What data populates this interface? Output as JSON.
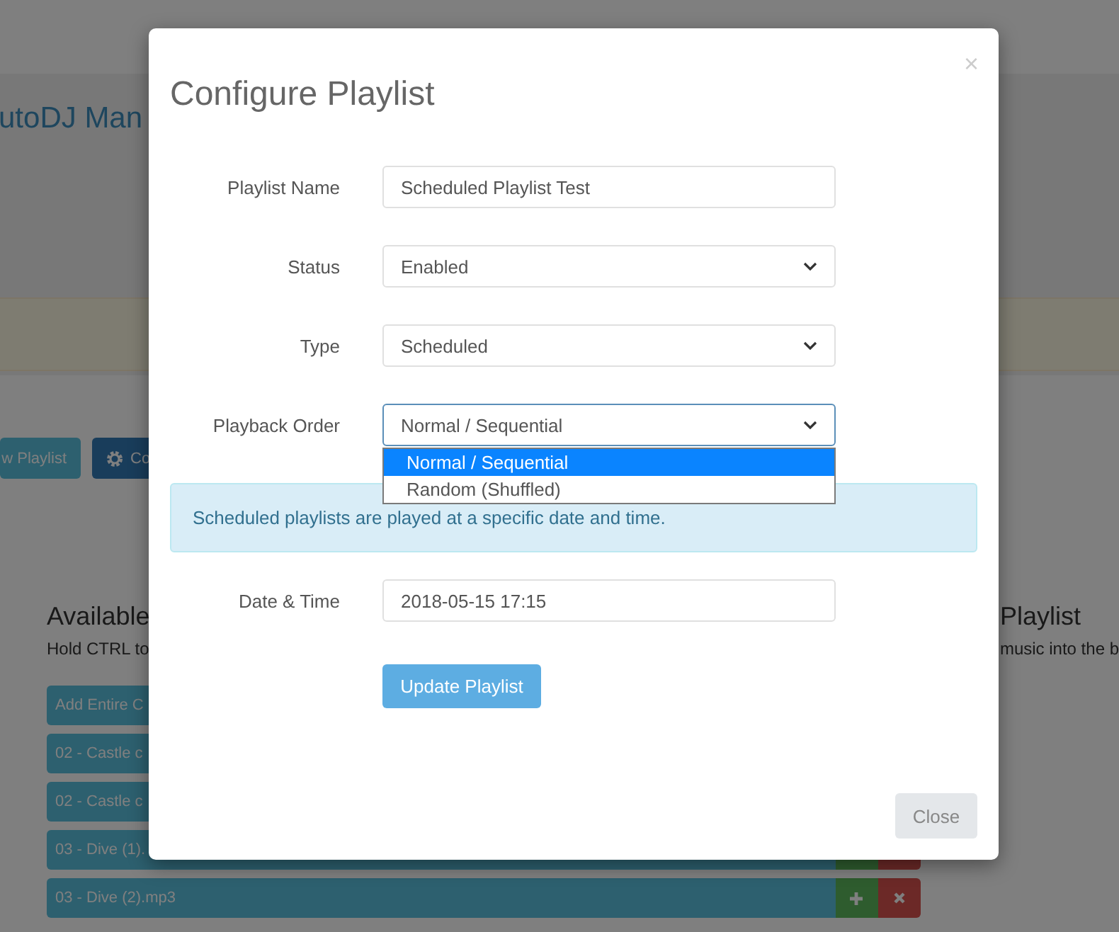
{
  "background": {
    "page_title": "utoDJ Man",
    "buttons": [
      {
        "label": "w Playlist",
        "kind": "info"
      },
      {
        "label": "Co",
        "kind": "primary"
      }
    ],
    "available": {
      "heading": "Available",
      "hint": "Hold CTRL to",
      "items": [
        {
          "label": "Add Entire C",
          "kind": "action"
        },
        {
          "label": "02 - Castle c",
          "kind": "track"
        },
        {
          "label": "02 - Castle c",
          "kind": "track"
        },
        {
          "label": "03 - Dive (1).",
          "kind": "song_covered"
        },
        {
          "label": "03 - Dive (2).mp3",
          "kind": "song"
        }
      ]
    },
    "playlist": {
      "heading": "Playlist",
      "hint": "music into the b"
    }
  },
  "modal": {
    "title": "Configure Playlist",
    "close": "×",
    "fields": [
      {
        "label": "Playlist Name",
        "kind": "text",
        "value": "Scheduled Playlist Test"
      },
      {
        "label": "Status",
        "kind": "select",
        "value": "Enabled",
        "expanded": false
      },
      {
        "label": "Type",
        "kind": "select",
        "value": "Scheduled",
        "expanded": false
      },
      {
        "label": "Playback Order",
        "kind": "select",
        "value": "Normal / Sequential",
        "expanded": true,
        "options": [
          {
            "label": "Normal / Sequential",
            "selected": true
          },
          {
            "label": "Random (Shuffled)",
            "selected": false
          }
        ]
      }
    ],
    "info": "Scheduled playlists are played at a specific date and time.",
    "date_field": {
      "label": "Date & Time",
      "value": "2018-05-15 17:15"
    },
    "submit": "Update Playlist",
    "footer_button": "Close"
  }
}
